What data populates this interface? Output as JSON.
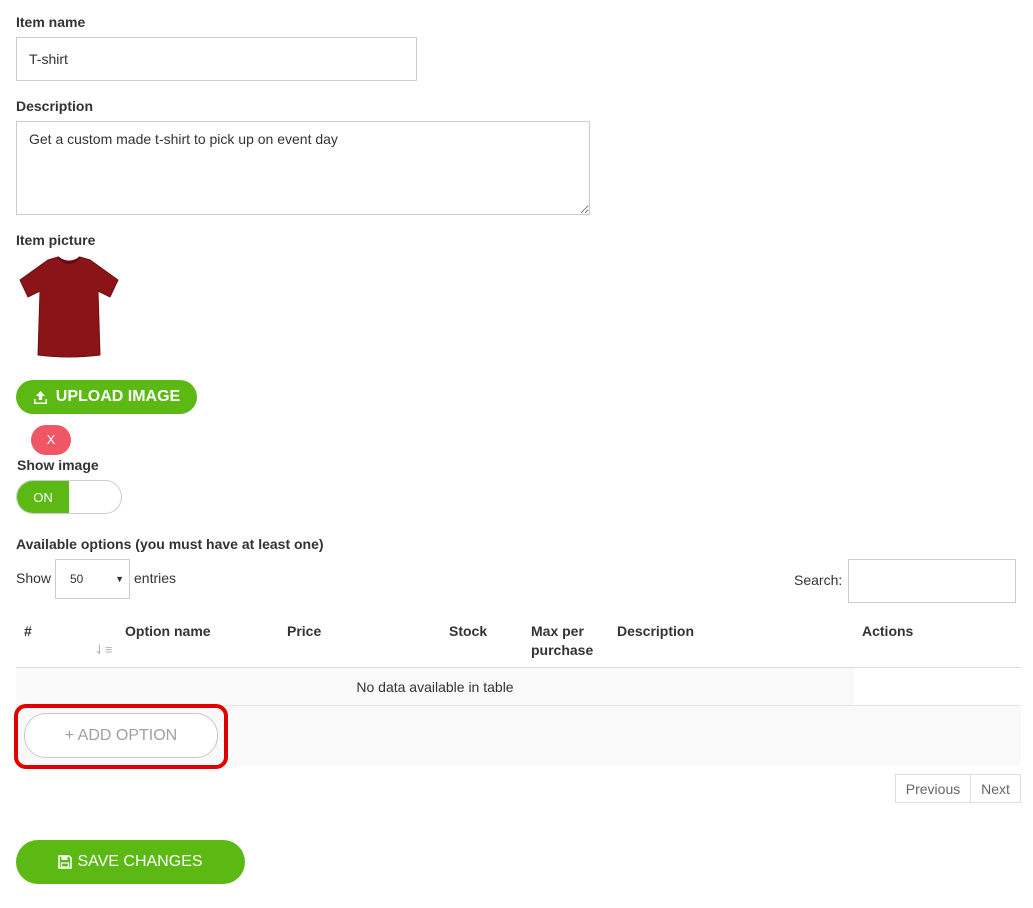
{
  "item_name": {
    "label": "Item name",
    "value": "T-shirt"
  },
  "description": {
    "label": "Description",
    "value": "Get a custom made t-shirt to pick up on event day"
  },
  "item_picture": {
    "label": "Item picture",
    "tshirt_color": "#8b1419"
  },
  "upload_button": {
    "icon": "upload-icon",
    "label": "UPLOAD IMAGE"
  },
  "remove_button": {
    "label": "X"
  },
  "show_image": {
    "label": "Show image",
    "state": "ON"
  },
  "options": {
    "label": "Available options (you must have at least one)",
    "show_label": "Show",
    "entries_value": "50",
    "entries_label": "entries",
    "search_label": "Search:",
    "search_value": "",
    "columns": [
      "#",
      "Option name",
      "Price",
      "Stock",
      "Max per purchase",
      "Description",
      "Actions"
    ],
    "empty_text": "No data available in table",
    "add_option_label": "+ ADD OPTION",
    "previous_label": "Previous",
    "next_label": "Next"
  },
  "save_button": {
    "icon": "floppy-disk-icon",
    "label": "SAVE CHANGES"
  },
  "colors": {
    "accent_green": "#5cb914",
    "danger_red": "#ef5767",
    "highlight_red": "#e00000"
  }
}
